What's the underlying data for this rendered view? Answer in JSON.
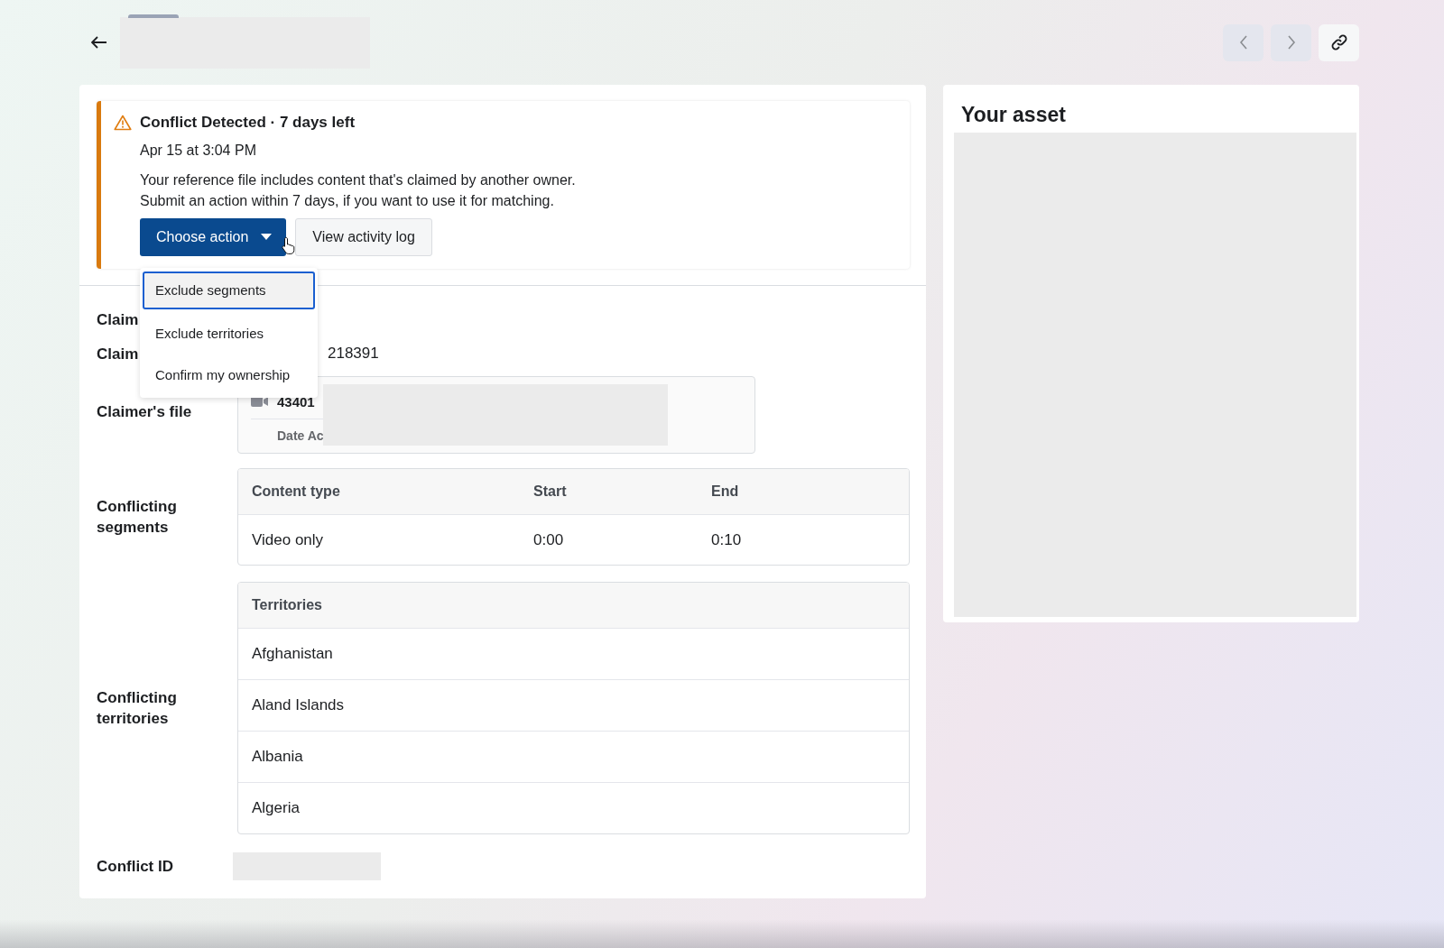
{
  "alert": {
    "title": "Conflict Detected · 7 days left",
    "timestamp": "Apr 15 at 3:04 PM",
    "message": [
      "Your reference file includes content that's claimed by another owner.",
      "Submit an action within 7 days, if you want to use it for matching."
    ],
    "primary_button": "Choose action",
    "secondary_button": "View activity log"
  },
  "action_menu": {
    "items": [
      {
        "label": "Exclude segments",
        "selected": true
      },
      {
        "label": "Exclude territories",
        "selected": false
      },
      {
        "label": "Confirm my ownership",
        "selected": false
      }
    ]
  },
  "details": {
    "claim_rows": [
      {
        "label": "Claim"
      },
      {
        "label": "Claim",
        "value": "218391"
      }
    ],
    "claimers_file": {
      "label": "Claimer's file",
      "file_id": "43401",
      "date_label": "Date Ac"
    },
    "segments": {
      "label": "Conflicting segments",
      "columns": [
        "Content type",
        "Start",
        "End"
      ],
      "rows": [
        [
          "Video only",
          "0:00",
          "0:10"
        ]
      ]
    },
    "territories": {
      "label": "Conflicting territories",
      "column": "Territories",
      "rows": [
        "Afghanistan",
        "Aland Islands",
        "Albania",
        "Algeria"
      ]
    },
    "conflict_id": {
      "label": "Conflict ID"
    }
  },
  "asset_panel": {
    "title": "Your asset"
  }
}
